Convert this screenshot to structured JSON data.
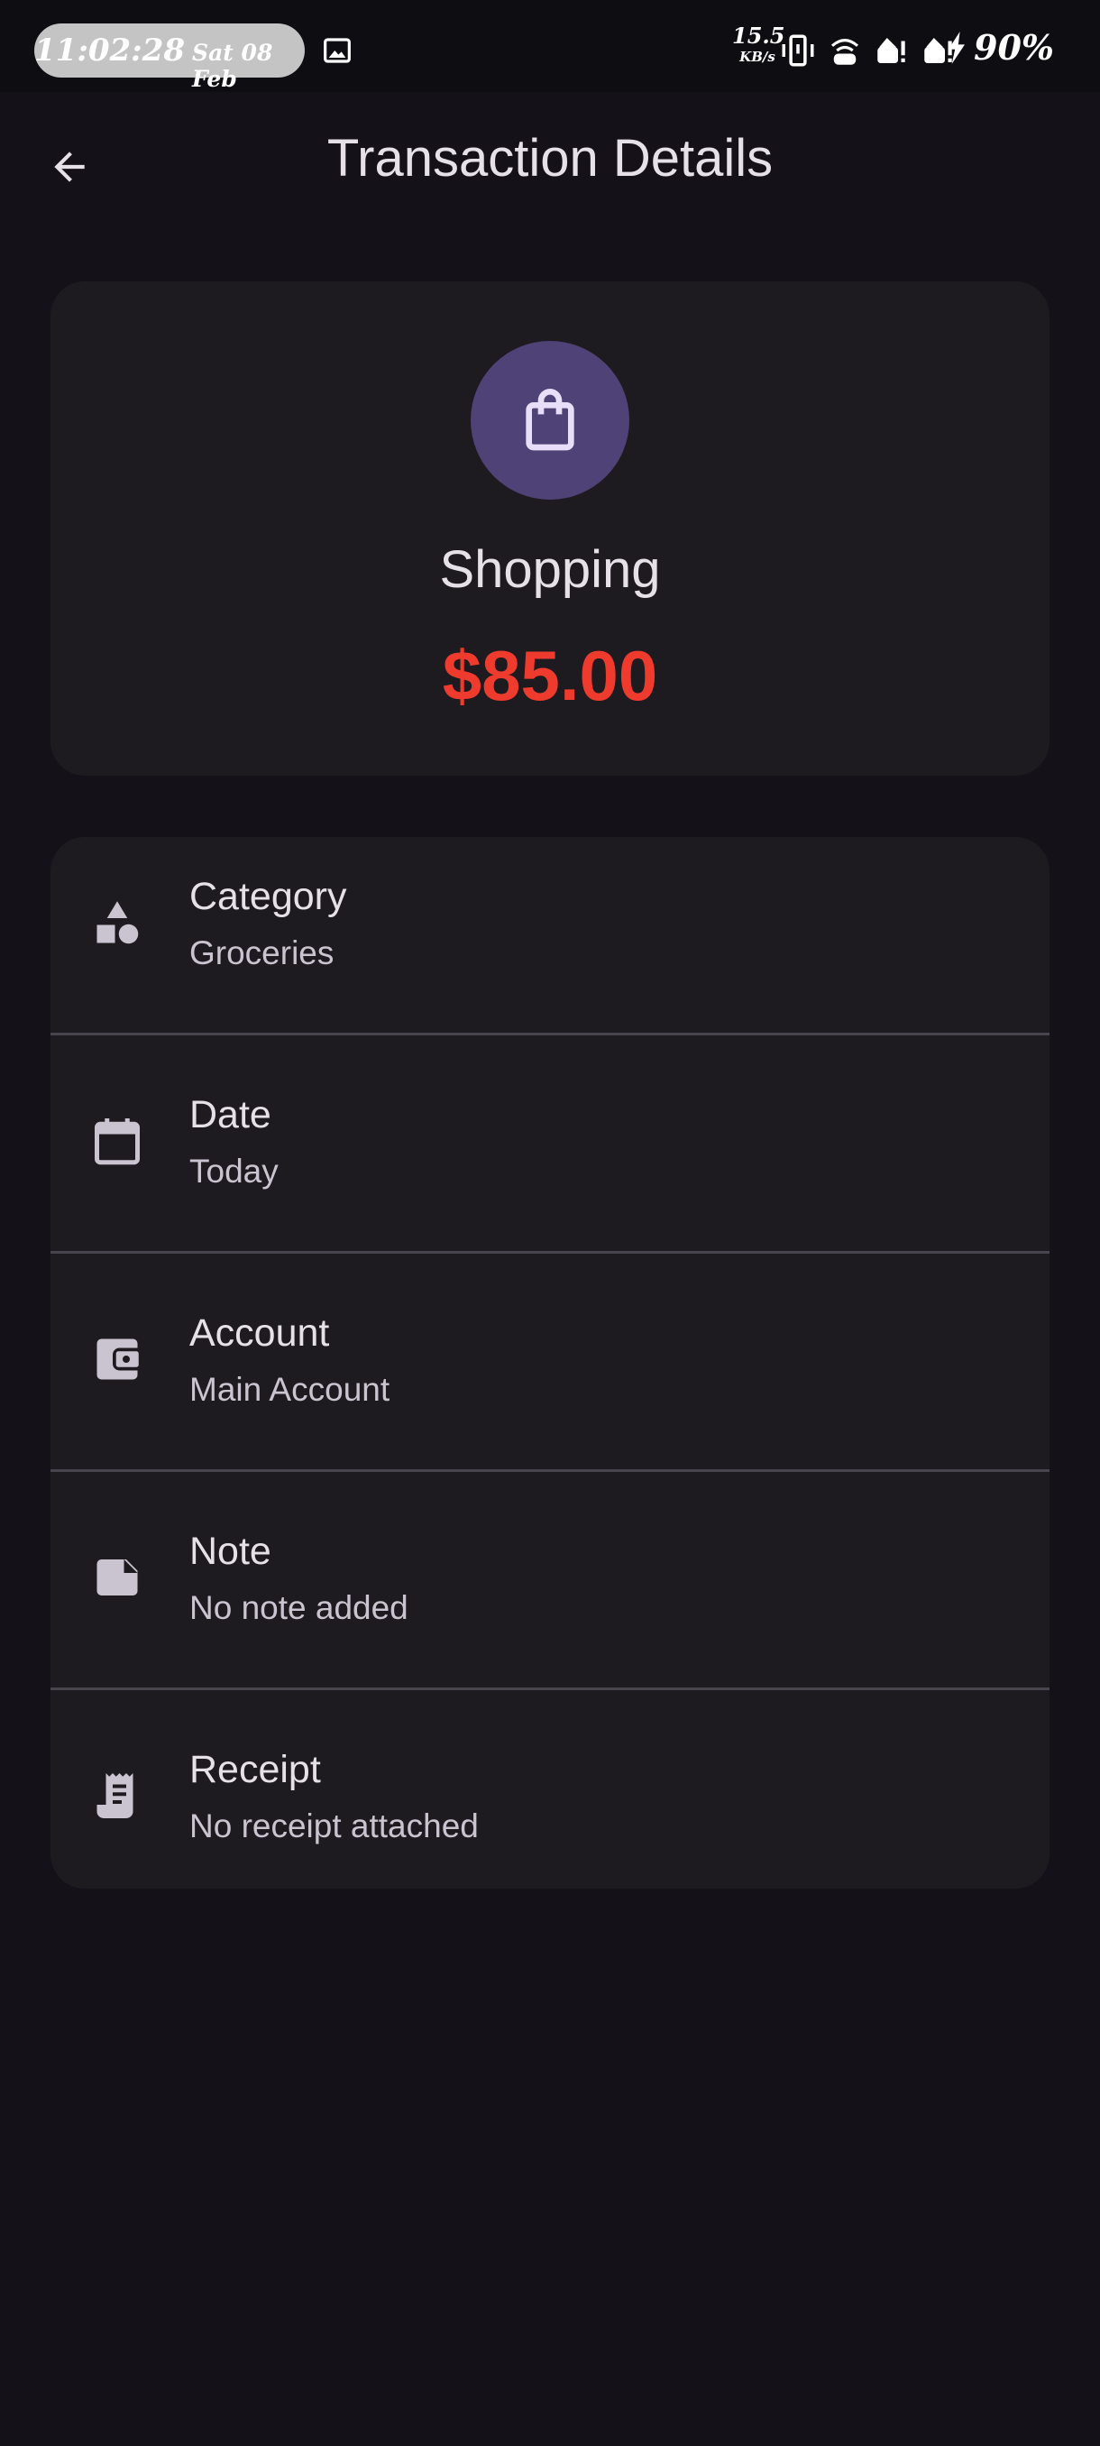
{
  "status_bar": {
    "time": "11:02:28",
    "date": "Sat 08 Feb",
    "net_speed": "15.5",
    "net_unit": "KB/s",
    "battery": "90%"
  },
  "app_bar": {
    "title": "Transaction Details",
    "back_icon": "arrow-back-icon"
  },
  "summary": {
    "icon": "shopping-bag-icon",
    "category_name": "Shopping",
    "amount": "$85.00",
    "amount_color": "#ef3b2e",
    "icon_bg_color": "#4f4276"
  },
  "details": [
    {
      "icon": "category-icon",
      "label": "Category",
      "value": "Groceries"
    },
    {
      "icon": "calendar-icon",
      "label": "Date",
      "value": "Today"
    },
    {
      "icon": "wallet-icon",
      "label": "Account",
      "value": "Main Account"
    },
    {
      "icon": "note-icon",
      "label": "Note",
      "value": "No note added"
    },
    {
      "icon": "receipt-icon",
      "label": "Receipt",
      "value": "No receipt attached"
    }
  ]
}
